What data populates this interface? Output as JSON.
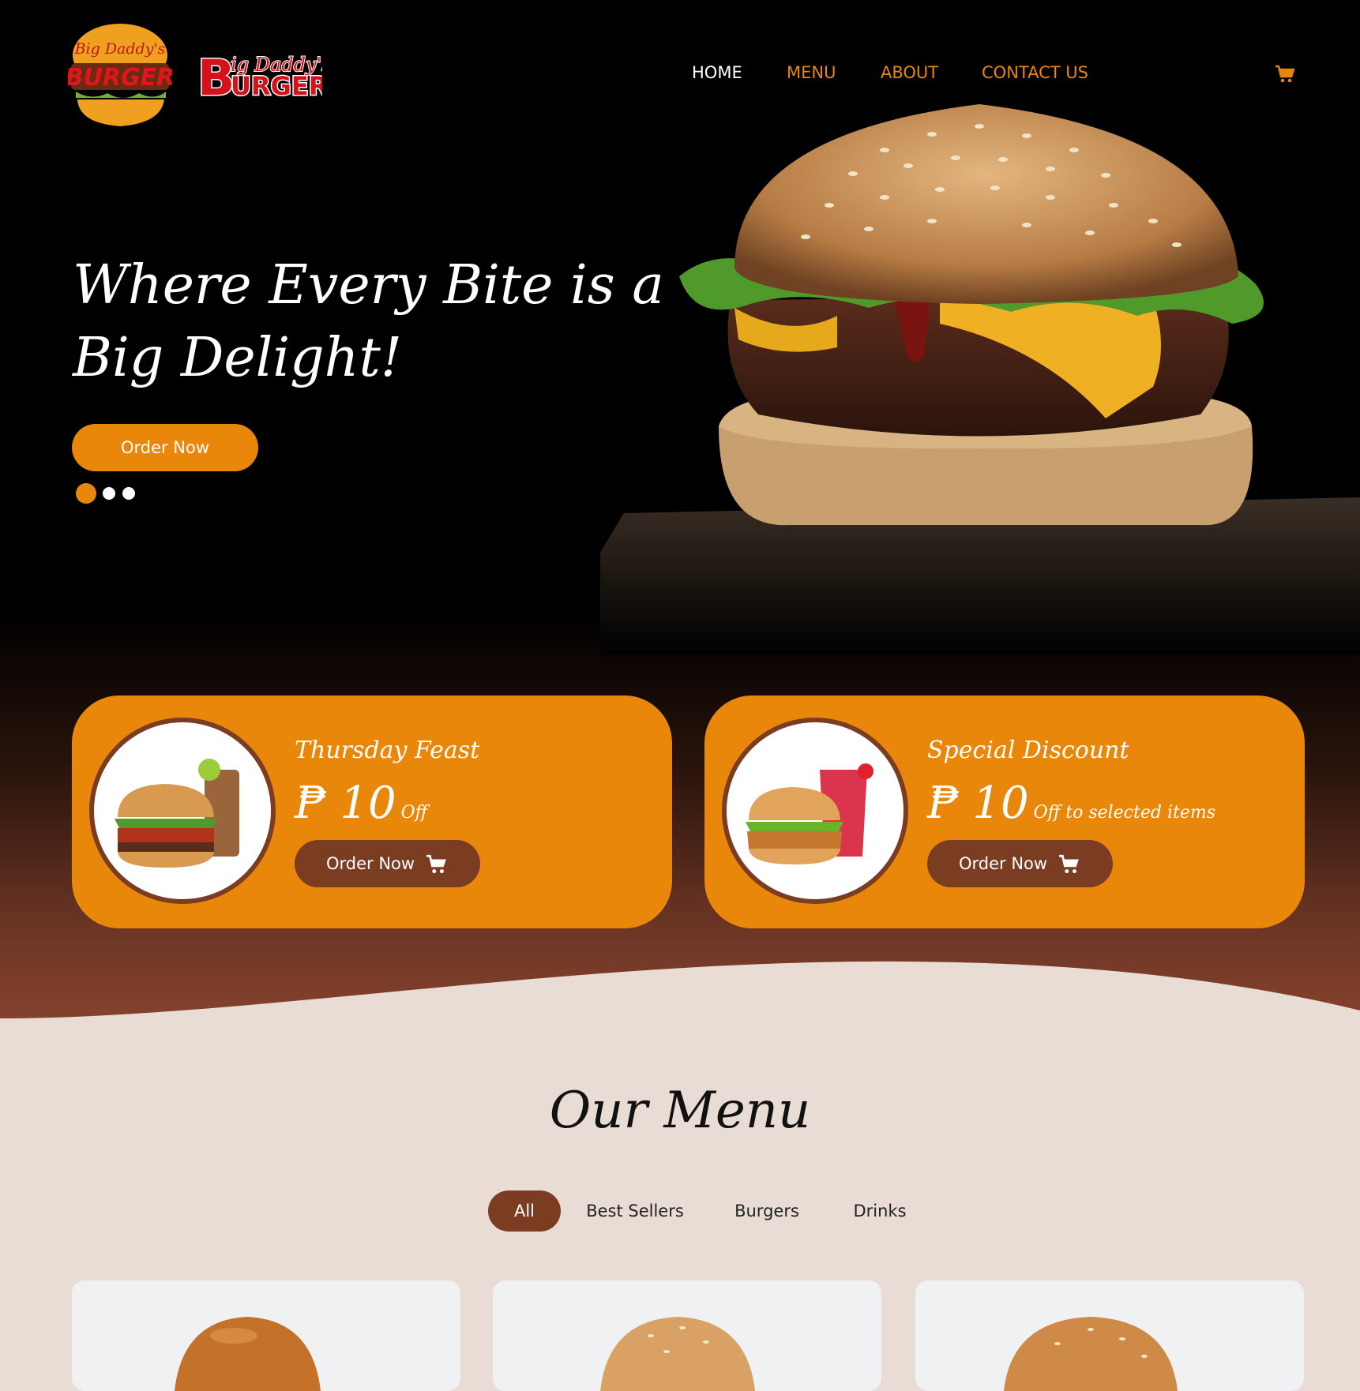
{
  "brand": {
    "badge_top": "Big Daddy's",
    "badge_main": "BURGER",
    "wordmark_small": "ig Daddy's",
    "wordmark_b": "B",
    "wordmark_rest": "URGER"
  },
  "nav": {
    "items": [
      "HOME",
      "MENU",
      "ABOUT",
      "CONTACT US"
    ],
    "active_index": 0
  },
  "hero": {
    "title": "Where Every Bite is a Big Delight!",
    "cta": "Order Now",
    "slides_total": 3,
    "slide_active": 1
  },
  "promos": [
    {
      "title": "Thursday Feast",
      "currency": "₱",
      "amount": "10",
      "suffix": "Off",
      "cta": "Order Now"
    },
    {
      "title": "Special Discount",
      "currency": "₱",
      "amount": "10",
      "suffix": "Off to selected items",
      "cta": "Order Now"
    }
  ],
  "menu": {
    "title": "Our Menu",
    "tabs": [
      "All",
      "Best Sellers",
      "Burgers",
      "Drinks"
    ],
    "active_tab": "All"
  },
  "colors": {
    "accent": "#e8870a",
    "brown": "#7b3d22",
    "cream": "#e8dcd4",
    "card": "#f0f1f3"
  },
  "icons": {
    "cart": "cart-icon"
  }
}
